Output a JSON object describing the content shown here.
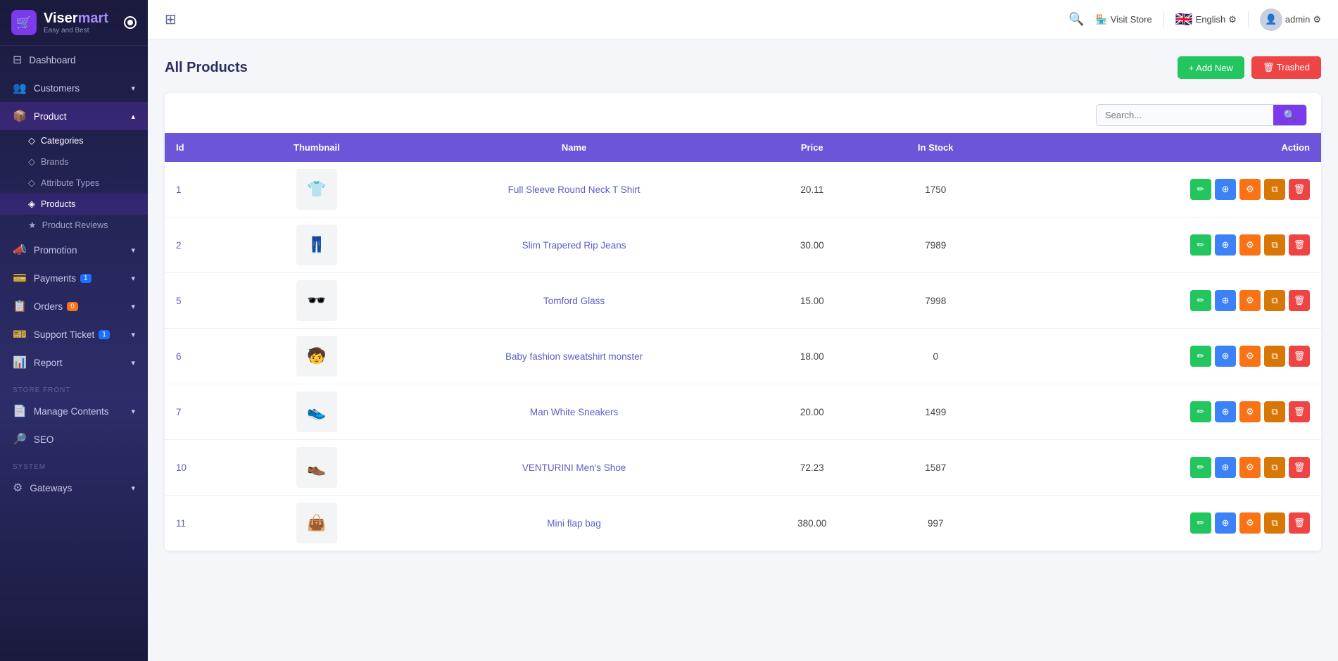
{
  "app": {
    "name_viser": "Viser",
    "name_mart": "mart",
    "tagline": "Easy and Best"
  },
  "topbar": {
    "grid_icon": "⊞",
    "search_icon": "🔍",
    "visit_store_label": "Visit Store",
    "language": "English",
    "admin_name": "admin"
  },
  "sidebar": {
    "items": [
      {
        "id": "dashboard",
        "label": "Dashboard",
        "icon": "⊟",
        "badge": null
      },
      {
        "id": "customers",
        "label": "Customers",
        "icon": "👥",
        "badge": null,
        "arrow": "▾"
      },
      {
        "id": "product",
        "label": "Product",
        "icon": "📦",
        "badge": null,
        "arrow": "▴",
        "active": true
      },
      {
        "id": "products",
        "label": "Products",
        "icon": "◈",
        "sub": true,
        "active": true
      },
      {
        "id": "categories",
        "label": "Categories",
        "icon": "◇",
        "sub": true
      },
      {
        "id": "brands",
        "label": "Brands",
        "icon": "◇",
        "sub": true
      },
      {
        "id": "attribute-types",
        "label": "Attribute Types",
        "icon": "◇",
        "sub": true
      },
      {
        "id": "product-reviews",
        "label": "Product Reviews",
        "icon": "★",
        "sub": true
      },
      {
        "id": "promotion",
        "label": "Promotion",
        "icon": "📣",
        "badge": null,
        "arrow": "▾"
      },
      {
        "id": "payments",
        "label": "Payments",
        "icon": "💳",
        "badge": "1",
        "arrow": "▾"
      },
      {
        "id": "orders",
        "label": "Orders",
        "icon": "📋",
        "badge": "0",
        "arrow": "▾"
      },
      {
        "id": "support-ticket",
        "label": "Support Ticket",
        "icon": "🎫",
        "badge": "1",
        "arrow": "▾"
      },
      {
        "id": "report",
        "label": "Report",
        "icon": "📊",
        "arrow": "▾"
      }
    ],
    "store_front_label": "STORE FRONT",
    "store_front_items": [
      {
        "id": "manage-contents",
        "label": "Manage Contents",
        "icon": "📄",
        "arrow": "▾"
      },
      {
        "id": "seo",
        "label": "SEO",
        "icon": "🔎"
      }
    ],
    "system_label": "SYSTEM",
    "system_items": [
      {
        "id": "gateways",
        "label": "Gateways",
        "icon": "⚙",
        "arrow": "▾"
      }
    ]
  },
  "page": {
    "title": "All Products",
    "add_new_label": "+ Add New",
    "trashed_label": "🗑 Trashed"
  },
  "search": {
    "placeholder": "Search..."
  },
  "table": {
    "headers": [
      {
        "key": "id",
        "label": "Id"
      },
      {
        "key": "thumbnail",
        "label": "Thumbnail"
      },
      {
        "key": "name",
        "label": "Name"
      },
      {
        "key": "price",
        "label": "Price"
      },
      {
        "key": "in_stock",
        "label": "In Stock"
      },
      {
        "key": "action",
        "label": "Action"
      }
    ],
    "rows": [
      {
        "id": "1",
        "thumbnail_icon": "👕",
        "name": "Full Sleeve Round Neck T Shirt",
        "price": "20.11",
        "in_stock": "1750"
      },
      {
        "id": "2",
        "thumbnail_icon": "👖",
        "name": "Slim Trapered Rip Jeans",
        "price": "30.00",
        "in_stock": "7989"
      },
      {
        "id": "5",
        "thumbnail_icon": "🕶️",
        "name": "Tomford Glass",
        "price": "15.00",
        "in_stock": "7998"
      },
      {
        "id": "6",
        "thumbnail_icon": "🧒",
        "name": "Baby fashion sweatshirt monster",
        "price": "18.00",
        "in_stock": "0"
      },
      {
        "id": "7",
        "thumbnail_icon": "👟",
        "name": "Man White Sneakers",
        "price": "20.00",
        "in_stock": "1499"
      },
      {
        "id": "10",
        "thumbnail_icon": "👞",
        "name": "VENTURINI Men's Shoe",
        "price": "72.23",
        "in_stock": "1587"
      },
      {
        "id": "11",
        "thumbnail_icon": "👜",
        "name": "Mini flap bag",
        "price": "380.00",
        "in_stock": "997"
      }
    ],
    "actions": {
      "edit_icon": "✏",
      "view_icon": "⊕",
      "settings_icon": "⚙",
      "duplicate_icon": "⧉",
      "delete_icon": "🗑"
    }
  }
}
